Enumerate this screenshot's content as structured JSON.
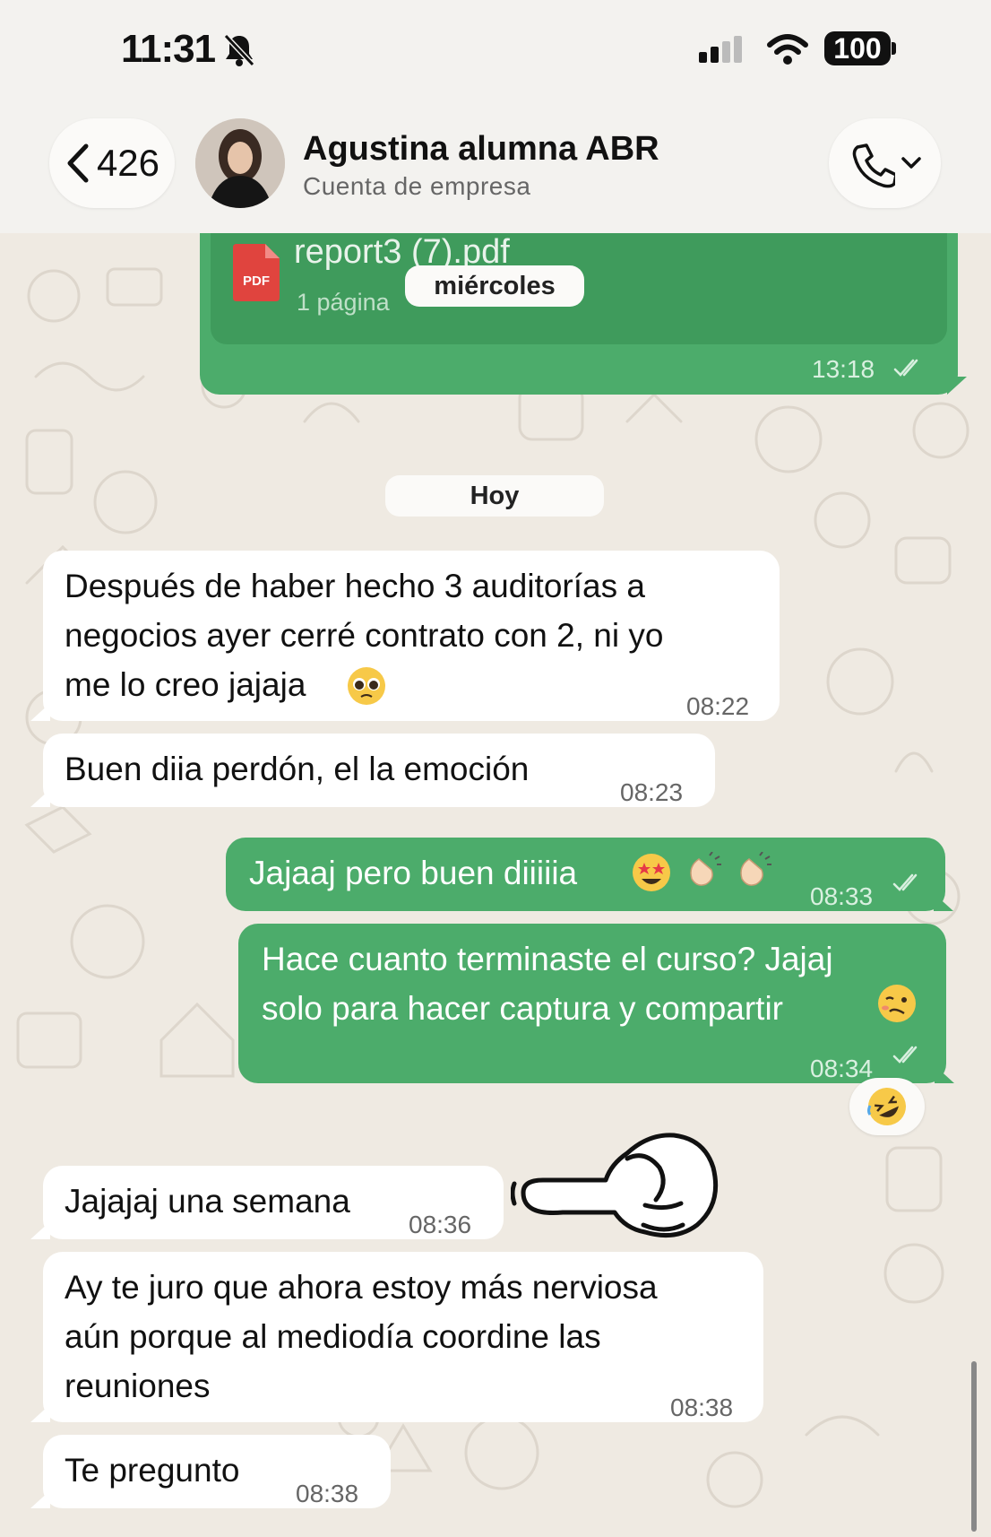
{
  "status_bar": {
    "time": "11:31",
    "battery": "100"
  },
  "header": {
    "back_count": "426",
    "contact_name": "Agustina alumna ABR",
    "contact_subtitle": "Cuenta de empresa"
  },
  "document_message": {
    "file_name": "report3 (7).pdf",
    "meta": "1 página",
    "time": "13:18"
  },
  "date_separators": {
    "floating": "miércoles",
    "today": "Hoy"
  },
  "messages": [
    {
      "dir": "in",
      "text": "Después de haber hecho 3 auditorías a\nnegocios ayer cerré contrato con 2, ni yo\nme lo creo jajaja",
      "emoji": "pleading-face",
      "time": "08:22"
    },
    {
      "dir": "in",
      "text": "Buen diia perdón, el la emoción",
      "time": "08:23"
    },
    {
      "dir": "out",
      "text": "Jajaaj pero buen diiiiia",
      "emoji": "star-struck clapping-hands clapping-hands",
      "time": "08:33"
    },
    {
      "dir": "out",
      "text": "Hace cuanto terminaste el curso? Jajaj\nsolo para hacer captura y compartir",
      "emoji": "woozy-face",
      "time": "08:34",
      "reaction": "rolling-on-floor-laughing"
    },
    {
      "dir": "in",
      "text": "Jajajaj una semana",
      "time": "08:36"
    },
    {
      "dir": "in",
      "text": "Ay te juro que ahora estoy más nerviosa\naún porque al mediodía coordine las\nreuniones",
      "time": "08:38"
    },
    {
      "dir": "in",
      "text": "Te pregunto",
      "time": "08:38"
    }
  ],
  "colors": {
    "outgoing": "#4cac6b",
    "incoming": "#ffffff",
    "background": "#efeae2"
  }
}
